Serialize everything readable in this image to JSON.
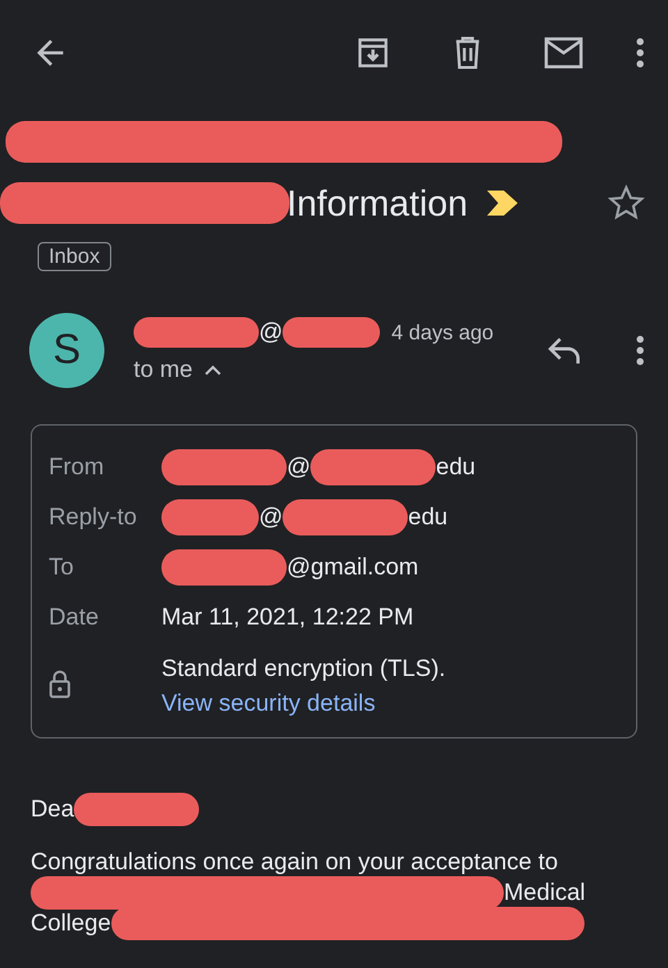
{
  "subject": {
    "parts": [
      {
        "kind": "redacted"
      },
      {
        "kind": "break"
      },
      {
        "kind": "redacted"
      },
      {
        "kind": "text",
        "text": "Information"
      }
    ],
    "important": true,
    "starred": false,
    "label": "Inbox"
  },
  "sender": {
    "avatar_letter": "S",
    "parts": [
      {
        "kind": "redacted"
      },
      {
        "kind": "text",
        "text": "@"
      },
      {
        "kind": "redacted"
      }
    ],
    "time": "4 days ago",
    "recipient": "to me",
    "expanded": true
  },
  "details": {
    "rows": [
      {
        "label": "From",
        "parts": [
          {
            "kind": "redacted"
          },
          {
            "kind": "text",
            "text": "@"
          },
          {
            "kind": "redacted"
          },
          {
            "kind": "text",
            "text": "edu"
          }
        ]
      },
      {
        "label": "Reply-to",
        "parts": [
          {
            "kind": "redacted"
          },
          {
            "kind": "text",
            "text": "@"
          },
          {
            "kind": "redacted"
          },
          {
            "kind": "text",
            "text": "edu"
          }
        ]
      },
      {
        "label": "To",
        "parts": [
          {
            "kind": "redacted"
          },
          {
            "kind": "text",
            "text": "@gmail.com"
          }
        ]
      },
      {
        "label": "Date",
        "parts": [
          {
            "kind": "text",
            "text": "Mar 11, 2021, 12:22 PM"
          }
        ]
      }
    ],
    "encryption": "Standard encryption (TLS).",
    "security_link": "View security details"
  },
  "body": {
    "lines": [
      {
        "parts": [
          {
            "kind": "text",
            "text": "Dea"
          },
          {
            "kind": "redacted"
          }
        ]
      },
      {
        "parts": [
          {
            "kind": "text",
            "text": "Congratulations once again on your acceptance to"
          }
        ]
      },
      {
        "parts": [
          {
            "kind": "redacted"
          },
          {
            "kind": "text",
            "text": "Medical"
          }
        ]
      },
      {
        "parts": [
          {
            "kind": "text",
            "text": "College"
          },
          {
            "kind": "redacted"
          }
        ]
      }
    ]
  }
}
